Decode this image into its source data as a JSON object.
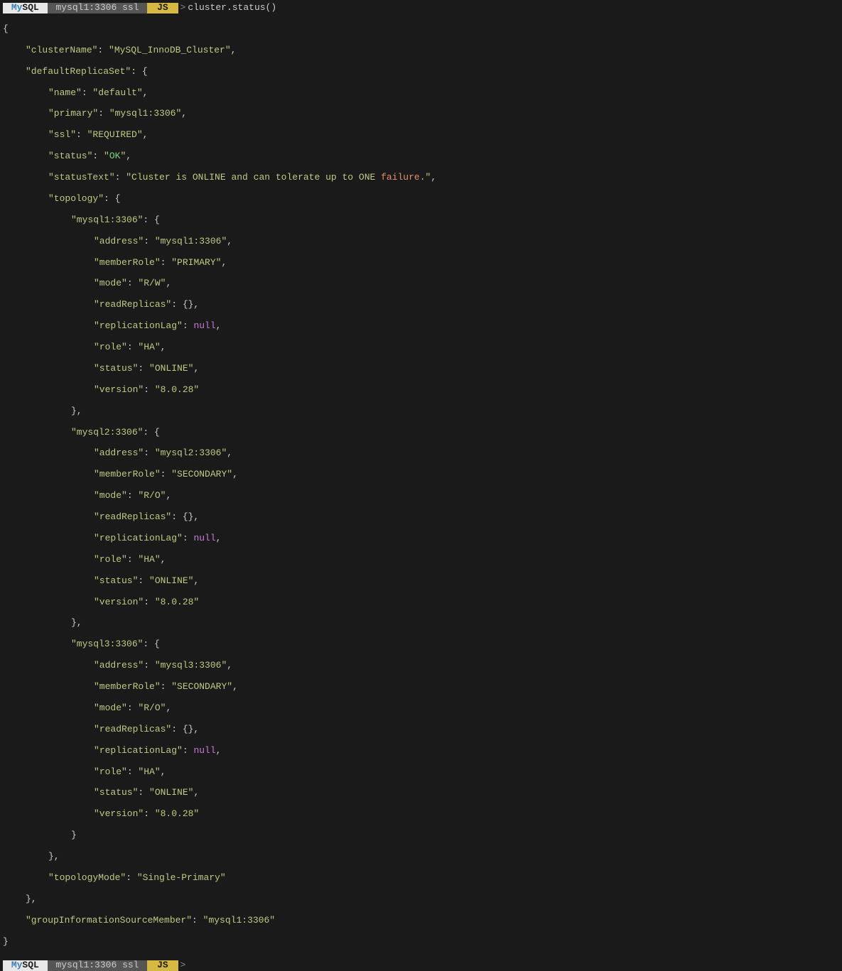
{
  "prompt": {
    "mysql_label_pre": "My",
    "mysql_label_post": "SQL",
    "host": "mysql1:3306 ssl",
    "js_label": "JS",
    "arrow": ">",
    "command": "cluster.status()"
  },
  "json_output": {
    "clusterName_key": "\"clusterName\"",
    "clusterName_val": "\"MySQL_InnoDB_Cluster\"",
    "defaultReplicaSet_key": "\"defaultReplicaSet\"",
    "name_key": "\"name\"",
    "name_val": "\"default\"",
    "primary_key": "\"primary\"",
    "primary_val": "\"mysql1:3306\"",
    "ssl_key": "\"ssl\"",
    "ssl_val": "\"REQUIRED\"",
    "status_key": "\"status\"",
    "status_val_pre": "\"",
    "status_val_ok": "OK",
    "status_val_post": "\"",
    "statusText_key": "\"statusText\"",
    "statusText_val_pre": "\"Cluster is ONLINE and can tolerate up to ONE ",
    "statusText_val_fail": "failure",
    "statusText_val_post": ".\"",
    "topology_key": "\"topology\"",
    "node1_key": "\"mysql1:3306\"",
    "node1_address_key": "\"address\"",
    "node1_address_val": "\"mysql1:3306\"",
    "node1_memberRole_key": "\"memberRole\"",
    "node1_memberRole_val": "\"PRIMARY\"",
    "node1_mode_key": "\"mode\"",
    "node1_mode_val": "\"R/W\"",
    "node1_readReplicas_key": "\"readReplicas\"",
    "node1_replicationLag_key": "\"replicationLag\"",
    "node1_replicationLag_val": "null",
    "node1_role_key": "\"role\"",
    "node1_role_val": "\"HA\"",
    "node1_status_key": "\"status\"",
    "node1_status_val": "\"ONLINE\"",
    "node1_version_key": "\"version\"",
    "node1_version_val": "\"8.0.28\"",
    "node2_key": "\"mysql2:3306\"",
    "node2_address_key": "\"address\"",
    "node2_address_val": "\"mysql2:3306\"",
    "node2_memberRole_key": "\"memberRole\"",
    "node2_memberRole_val": "\"SECONDARY\"",
    "node2_mode_key": "\"mode\"",
    "node2_mode_val": "\"R/O\"",
    "node2_readReplicas_key": "\"readReplicas\"",
    "node2_replicationLag_key": "\"replicationLag\"",
    "node2_replicationLag_val": "null",
    "node2_role_key": "\"role\"",
    "node2_role_val": "\"HA\"",
    "node2_status_key": "\"status\"",
    "node2_status_val": "\"ONLINE\"",
    "node2_version_key": "\"version\"",
    "node2_version_val": "\"8.0.28\"",
    "node3_key": "\"mysql3:3306\"",
    "node3_address_key": "\"address\"",
    "node3_address_val": "\"mysql3:3306\"",
    "node3_memberRole_key": "\"memberRole\"",
    "node3_memberRole_val": "\"SECONDARY\"",
    "node3_mode_key": "\"mode\"",
    "node3_mode_val": "\"R/O\"",
    "node3_readReplicas_key": "\"readReplicas\"",
    "node3_replicationLag_key": "\"replicationLag\"",
    "node3_replicationLag_val": "null",
    "node3_role_key": "\"role\"",
    "node3_role_val": "\"HA\"",
    "node3_status_key": "\"status\"",
    "node3_status_val": "\"ONLINE\"",
    "node3_version_key": "\"version\"",
    "node3_version_val": "\"8.0.28\"",
    "topologyMode_key": "\"topologyMode\"",
    "topologyMode_val": "\"Single-Primary\"",
    "groupInfo_key": "\"groupInformationSourceMember\"",
    "groupInfo_val": "\"mysql1:3306\""
  }
}
